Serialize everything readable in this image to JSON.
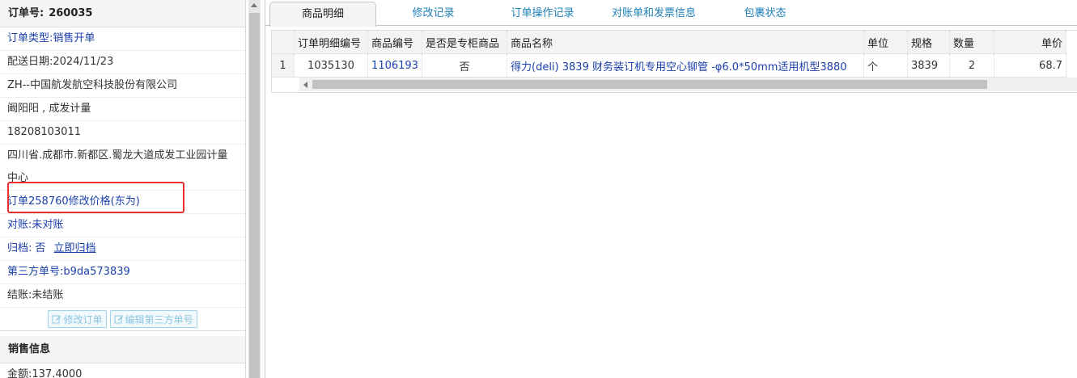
{
  "order": {
    "title_label": "订单号:",
    "title_value": "260035",
    "type_label": "订单类型:",
    "type_value": "销售开单",
    "delivery_label": "配送日期:",
    "delivery_value": "2024/11/23",
    "company": "ZH--中国航发航空科技股份有限公司",
    "contact": "阚阳阳 , 成发计量",
    "phone": "18208103011",
    "address": "四川省.成都市.新都区.蜀龙大道成发工业园计量中心",
    "modify_note": "订单258760修改价格(东为)",
    "recon_label": "对账:",
    "recon_value": "未对账",
    "archive_label": "归档:",
    "archive_value": "否",
    "archive_link": "立即归档",
    "third_label": "第三方单号:",
    "third_value": "b9da573839",
    "settle_label": "结账:",
    "settle_value": "未结账",
    "edit_order_btn": "修改订单",
    "edit_third_btn": "编辑第三方单号"
  },
  "sales": {
    "header": "销售信息",
    "amount_label": "金额:",
    "amount_value": "137.4000"
  },
  "tabs": [
    "商品明细",
    "修改记录",
    "订单操作记录",
    "对账单和发票信息",
    "包裹状态"
  ],
  "table": {
    "columns": [
      "订单明细编号",
      "商品编号",
      "是否是专柜商品",
      "商品名称",
      "单位",
      "规格",
      "数量",
      "单价"
    ],
    "rows": [
      {
        "index": "1",
        "detail_id": "1035130",
        "product_id": "1106193",
        "is_counter": "否",
        "name": "得力(deli) 3839 财务装订机专用空心铆管 -φ6.0*50mm适用机型3880",
        "unit": "个",
        "spec": "3839",
        "qty": "2",
        "price": "68.7"
      }
    ]
  },
  "colors": {
    "link": "#1a3fa8",
    "tab_text": "#1d7fb8",
    "highlight": "#e8312f"
  }
}
